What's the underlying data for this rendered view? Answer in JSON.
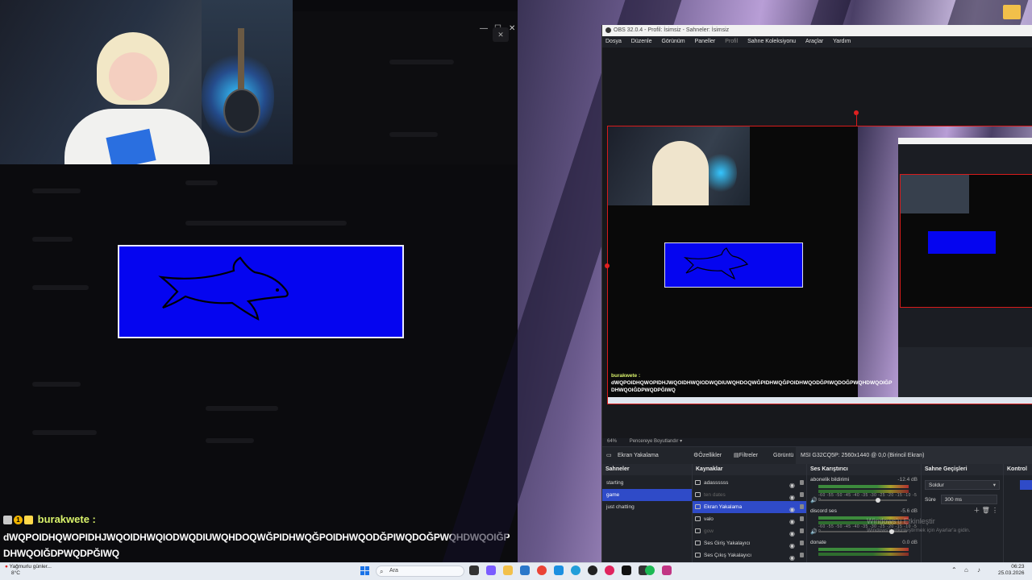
{
  "chat": {
    "username": "burakwete :",
    "message": "dWQPOIDHQWOPIDHJWQOIDHWQIODWQDIUWQHDOQWĞPIDHWQĞPOIDHWQODĞPIWQDOĞPWQHDWQOIĞP DHWQOIĞDPWQDPĞIWQ",
    "badge_count": "1"
  },
  "discord_window": {
    "close": "✕",
    "min": "—",
    "max": "☐",
    "x": "✕"
  },
  "obs": {
    "title": "OBS 32.0.4 - Profil: İsimsiz - Sahneler: İsimsiz",
    "menu": [
      "Dosya",
      "Düzenle",
      "Görünüm",
      "Paneller",
      "Profil",
      "Sahne Koleksiyonu",
      "Araçlar",
      "Yardım"
    ],
    "preview_chat_user": "burakwete :",
    "preview_chat_msg": "dWQPOIDHQWOPIDHJWQOIDHWQIODWQDIUWQHDOQWĞPIDHWQĞPOIDHWQODĞPIWQDOĞPWQHDWQOIĞP DHWQOIĞDPWQDPĞIWQ",
    "zoom": "64%",
    "fit_label": "Pencereye Boyutlandır",
    "source_bar": {
      "selected_source": "Ekran Yakalama",
      "properties": "Özellikler",
      "filters": "Filtreler",
      "display_label": "Görüntü",
      "display_value": "MSI G32CQ5P: 2560x1440 @ 0,0 (Birincil Ekran)"
    },
    "scenes_header": "Sahneler",
    "scenes": [
      "starting",
      "game",
      "just chatting"
    ],
    "selected_scene_index": 1,
    "sources_header": "Kaynaklar",
    "sources": [
      {
        "name": "adassssss",
        "state": "normal"
      },
      {
        "name": "ten dates",
        "state": "dim"
      },
      {
        "name": "Ekran Yakalama",
        "state": "selected"
      },
      {
        "name": "valo",
        "state": "normal"
      },
      {
        "name": "gow",
        "state": "dim"
      },
      {
        "name": "Ses Giriş Yakalayıcı",
        "state": "normal"
      },
      {
        "name": "Ses Çıkış Yakalayıcı",
        "state": "normal"
      }
    ],
    "mixer_header": "Ses Karıştırıcı",
    "mixer": [
      {
        "name": "abonelik bildirimi",
        "db": "-12.4 dB",
        "level": 0.68
      },
      {
        "name": "discord ses",
        "db": "-5.6 dB",
        "level": 0.85
      },
      {
        "name": "donate",
        "db": "0.0 dB",
        "level": 1.0
      }
    ],
    "mixer_scale": "-60 -55 -50 -45 -40 -35 -30 -25 -20 -15 -10 -5 0",
    "transitions_header": "Sahne Geçişleri",
    "transition_value": "Soldur",
    "duration_label": "Süre",
    "duration_value": "300 ms",
    "controls_header": "Kontrol"
  },
  "windows_activation": {
    "line1": "Windows'u Etkinleştir",
    "line2": "Windows'u etkinleştirmek için Ayarlar'a gidin."
  },
  "taskbar": {
    "weather_title": "Yağmurlu günler...",
    "weather_temp": "8°C",
    "search_placeholder": "Ara",
    "time": "06:23",
    "date": "25.03.2026"
  }
}
